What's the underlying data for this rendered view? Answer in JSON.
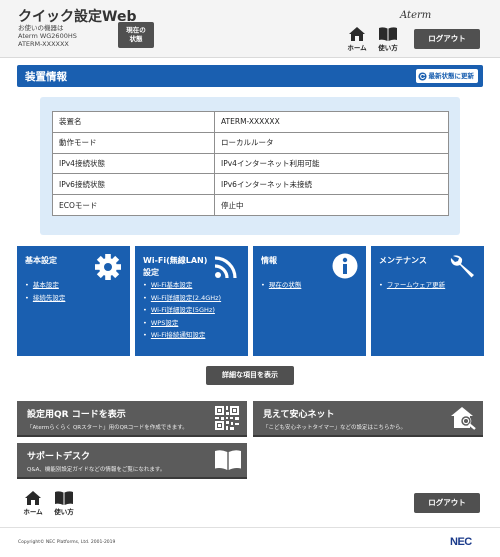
{
  "header": {
    "app_title": "クイック設定Web",
    "device_label": "お使いの機器は",
    "device_model": "Aterm WG2600HS",
    "device_name": "ATERM-XXXXXX",
    "status_button": "現在の\n状態",
    "brand": "Aterm",
    "nav": {
      "home": "ホーム",
      "help": "使い方"
    },
    "logout": "ログアウト"
  },
  "section": {
    "title": "装置情報",
    "refresh": "最新状態に更新"
  },
  "device_info": [
    {
      "key": "装置名",
      "value": "ATERM-XXXXXX"
    },
    {
      "key": "動作モード",
      "value": "ローカルルータ"
    },
    {
      "key": "IPv4接続状態",
      "value": "IPv4インターネット利用可能"
    },
    {
      "key": "IPv6接続状態",
      "value": "IPv6インターネット未接続"
    },
    {
      "key": "ECOモード",
      "value": "停止中"
    }
  ],
  "tiles": [
    {
      "title": "基本設定",
      "icon": "gear-icon",
      "links": [
        "基本設定",
        "接続先設定"
      ]
    },
    {
      "title": "Wi-Fi(無線LAN)\n設定",
      "icon": "wifi-icon",
      "links": [
        "Wi-Fi基本設定",
        "Wi-Fi詳細設定(2.4GHz)",
        "Wi-Fi詳細設定(5GHz)",
        "WPS設定",
        "Wi-Fi接続通知設定"
      ]
    },
    {
      "title": "情報",
      "icon": "info-icon",
      "links": [
        "現在の状態"
      ]
    },
    {
      "title": "メンテナンス",
      "icon": "wrench-icon",
      "links": [
        "ファームウェア更新"
      ]
    }
  ],
  "detail_button": "詳細な項目を表示",
  "cards": [
    {
      "title": "設定用QR コードを表示",
      "desc": "「Atermらくらく QRスタート」用のQRコードを作成できます。",
      "icon": "qr-code-icon"
    },
    {
      "title": "見えて安心ネット",
      "desc": "「こども安心ネットタイマー」などの設定はこちらから。",
      "icon": "home-search-icon"
    },
    {
      "title": "サポートデスク",
      "desc": "Q&A、機能別設定ガイドなどの情報をご覧になれます。",
      "icon": "book-icon"
    }
  ],
  "footer": {
    "copyright": "Copyright© NEC Platforms, Ltd. 2001-2019",
    "brand": "NEC"
  },
  "colors": {
    "accent": "#1a5fb0",
    "button": "#505050",
    "panel": "#dcebf9"
  }
}
